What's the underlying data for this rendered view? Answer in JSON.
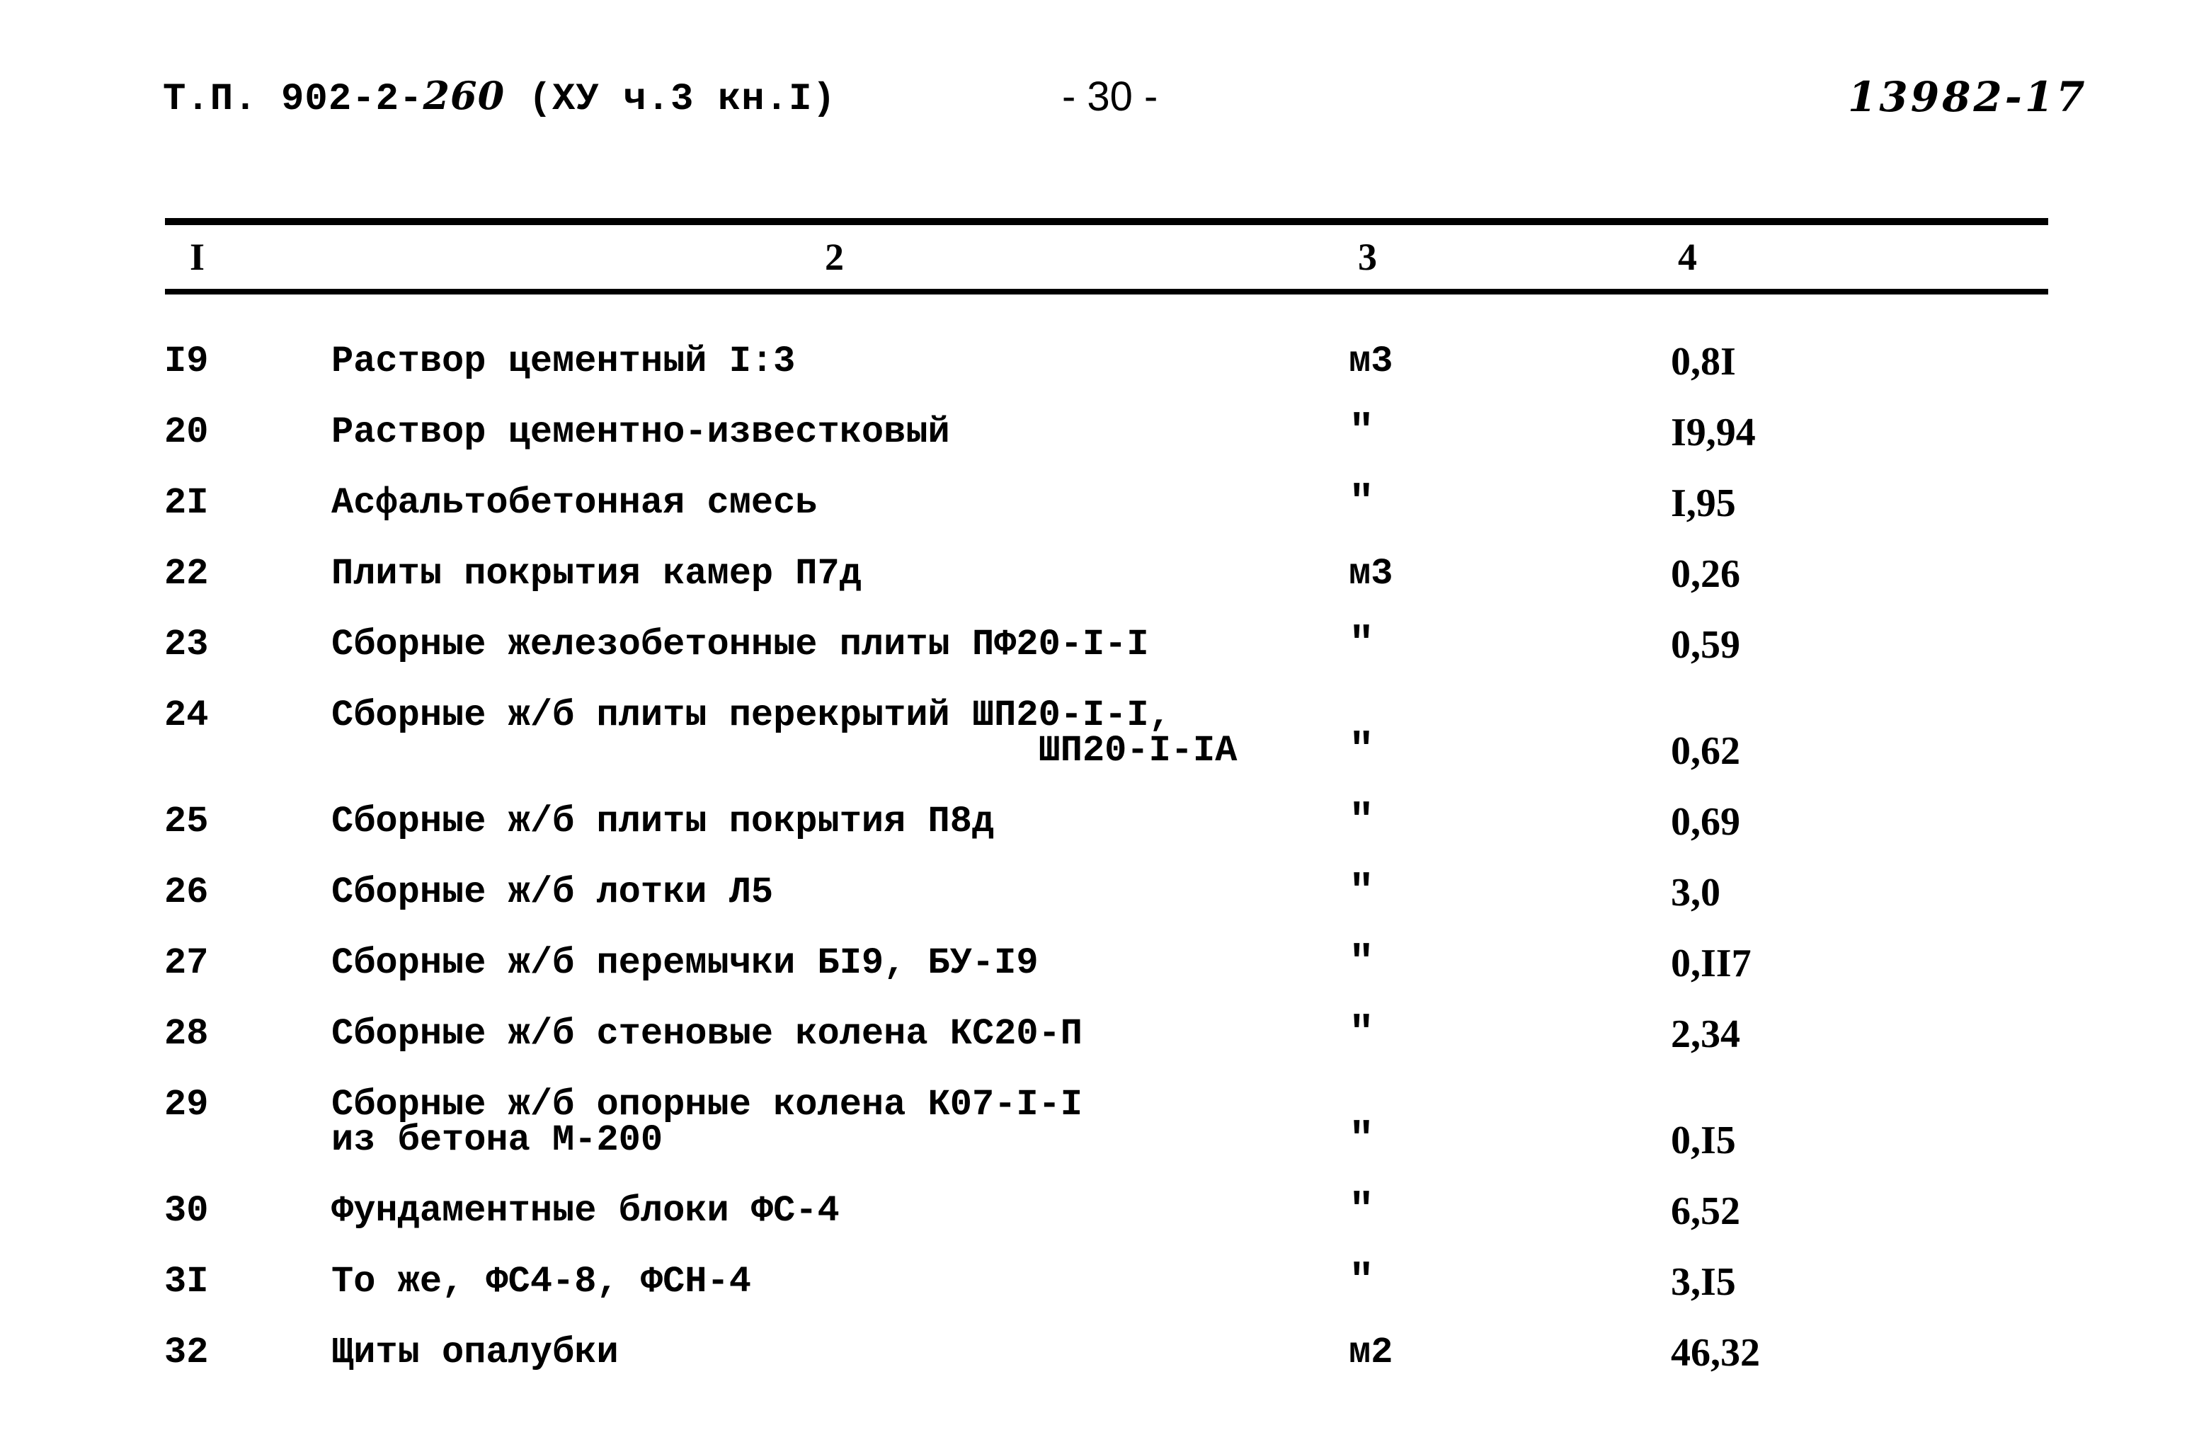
{
  "header": {
    "doc_code_prefix": "Т.П. 902-2-",
    "doc_code_handwritten": "260",
    "doc_code_suffix": " (ХУ ч.3 кн.I)",
    "page_number": "- 30 -",
    "registration_number": "13982-17"
  },
  "table": {
    "column_headers": [
      "I",
      "2",
      "3",
      "4"
    ],
    "rows": [
      {
        "num": "I9",
        "name": "Раствор цементный I:3",
        "name_line2": "",
        "unit": "м3",
        "value": "0,8I"
      },
      {
        "num": "20",
        "name": "Раствор цементно-известковый",
        "name_line2": "",
        "unit": "\"",
        "value": "I9,94"
      },
      {
        "num": "2I",
        "name": "Асфальтобетонная смесь",
        "name_line2": "",
        "unit": "\"",
        "value": "I,95"
      },
      {
        "num": "22",
        "name": "Плиты покрытия камер П7д",
        "name_line2": "",
        "unit": "м3",
        "value": "0,26"
      },
      {
        "num": "23",
        "name": "Сборные железобетонные плиты ПФ20-I-I",
        "name_line2": "",
        "unit": "\"",
        "value": "0,59"
      },
      {
        "num": "24",
        "name": "Сборные ж/б плиты перекрытий ШП20-I-I,",
        "name_line2": "                                ШП20-I-IА",
        "unit": "\"",
        "value": "0,62"
      },
      {
        "num": "25",
        "name": "Сборные ж/б плиты покрытия П8д",
        "name_line2": "",
        "unit": "\"",
        "value": "0,69"
      },
      {
        "num": "26",
        "name": "Сборные ж/б лотки Л5",
        "name_line2": "",
        "unit": "\"",
        "value": "3,0"
      },
      {
        "num": "27",
        "name": "Сборные ж/б перемычки БI9, БУ-I9",
        "name_line2": "",
        "unit": "\"",
        "value": "0,II7"
      },
      {
        "num": "28",
        "name": "Сборные ж/б стеновые колена КС20-П",
        "name_line2": "",
        "unit": "\"",
        "value": "2,34"
      },
      {
        "num": "29",
        "name": "Сборные ж/б опорные колена К07-I-I",
        "name_line2": "из бетона М-200",
        "unit": "\"",
        "value": "0,I5"
      },
      {
        "num": "30",
        "name": "Фундаментные блоки ФС-4",
        "name_line2": "",
        "unit": "\"",
        "value": "6,52"
      },
      {
        "num": "3I",
        "name": "То же, ФС4-8, ФСН-4",
        "name_line2": "",
        "unit": "\"",
        "value": "3,I5"
      },
      {
        "num": "32",
        "name": "Щиты опалубки",
        "name_line2": "",
        "unit": "м2",
        "value": "46,32"
      }
    ]
  }
}
